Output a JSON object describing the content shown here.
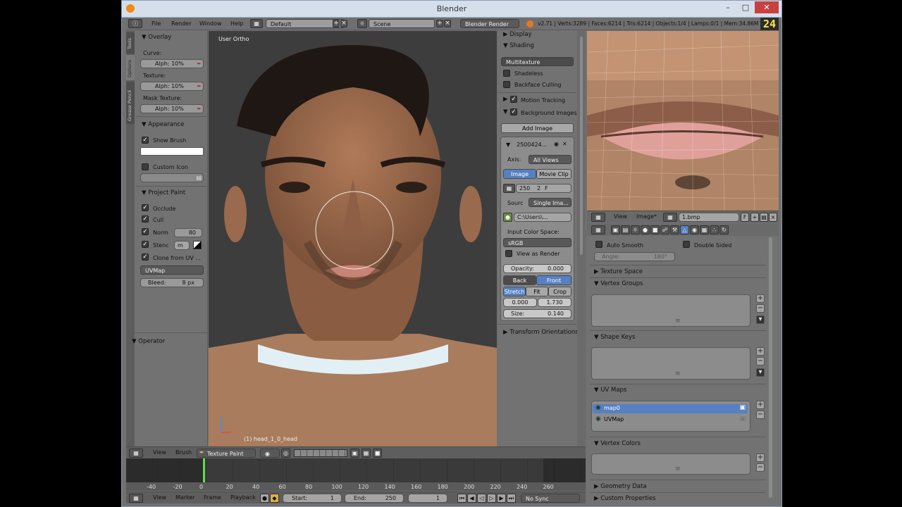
{
  "window": {
    "title": "Blender",
    "fps_badge": "24"
  },
  "menubar": {
    "menus": [
      "File",
      "Render",
      "Window",
      "Help"
    ],
    "layout": "Default",
    "scene": "Scene",
    "engine": "Blender Render",
    "stats": "v2.71 | Verts:3289 | Faces:6214 | Tris:6214 | Objects:1/4 | Lamps:0/1 | Mem:34.86M"
  },
  "left_tabs": [
    "Tools",
    "Options",
    "Grease Pencil"
  ],
  "left_panel": {
    "overlay": {
      "header": "Overlay",
      "curve_label": "Curve:",
      "curve_alpha": "Alph: 10%",
      "texture_label": "Texture:",
      "texture_alpha": "Alph: 10%",
      "mask_label": "Mask Texture:",
      "mask_alpha": "Alph: 10%"
    },
    "appearance": {
      "header": "Appearance",
      "show_brush": "Show Brush",
      "custom_icon": "Custom Icon"
    },
    "project_paint": {
      "header": "Project Paint",
      "occlude": "Occlude",
      "cull": "Cull",
      "normal_label": "Norm",
      "normal_value": "80",
      "stencil_label": "Stenc",
      "stencil_value": "m",
      "clone": "Clone from UV ...",
      "uvmap": "UVMap",
      "bleed": "Bleed:",
      "bleed_value": "8 px"
    },
    "operator": {
      "header": "Operator"
    }
  },
  "viewport": {
    "view_label": "User Ortho",
    "object_label": "(1) head_1_0_head"
  },
  "properties": {
    "display": "Display",
    "shading": "Shading",
    "shading_mode": "Multitexture",
    "shadeless": "Shadeless",
    "backface": "Backface Culling",
    "motion_tracking": "Motion Tracking",
    "background_images": "Background Images",
    "add_image": "Add Image",
    "image_name": "2500424...",
    "axis_label": "Axis:",
    "axis_value": "All Views",
    "tab_image": "Image",
    "tab_movie": "Movie Clip",
    "frame_value": "250",
    "frame_num": "2",
    "frame_f": "F",
    "source_label": "Sourc",
    "source_value": "Single Ima...",
    "path_value": "C:\\Users\\...",
    "input_color_label": "Input Color Space:",
    "color_space": "sRGB",
    "view_as_render": "View as Render",
    "opacity_label": "Opacity:",
    "opacity_value": "0.000",
    "back": "Back",
    "front": "Front",
    "stretch": "Stretch",
    "fit": "Fit",
    "crop": "Crop",
    "offset_x": "0.000",
    "offset_y": "1.730",
    "size_label": "Size:",
    "size_value": "0.140",
    "transform_orientations": "Transform Orientations"
  },
  "uv_header": {
    "view": "View",
    "image": "Image*",
    "image_name": "1.bmp",
    "f": "F"
  },
  "right_props": {
    "auto_smooth": "Auto Smooth",
    "double_sided": "Double Sided",
    "angle_label": "Angle:",
    "angle_value": "180°",
    "texture_space": "Texture Space",
    "vertex_groups": "Vertex Groups",
    "shape_keys": "Shape Keys",
    "uv_maps": "UV Maps",
    "uv_map_items": [
      "map0",
      "UVMap"
    ],
    "vertex_colors": "Vertex Colors",
    "geometry_data": "Geometry Data",
    "custom_properties": "Custom Properties"
  },
  "viewport_header": {
    "view": "View",
    "brush": "Brush",
    "mode": "Texture Paint"
  },
  "timeline": {
    "ruler_ticks": [
      "-40",
      "-20",
      "0",
      "20",
      "40",
      "60",
      "80",
      "100",
      "120",
      "140",
      "160",
      "180",
      "200",
      "220",
      "240",
      "260"
    ],
    "current_frame_value": 0
  },
  "timeline_header": {
    "view": "View",
    "marker": "Marker",
    "frame": "Frame",
    "playback": "Playback",
    "start_label": "Start:",
    "start_value": "1",
    "end_label": "End:",
    "end_value": "250",
    "current": "1",
    "sync": "No Sync"
  }
}
